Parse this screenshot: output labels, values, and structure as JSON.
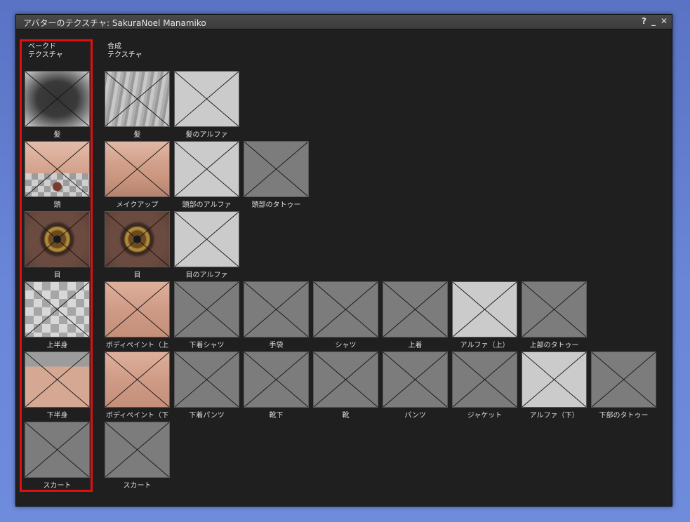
{
  "window": {
    "title": "アバターのテクスチャ: SakuraNoel Manamiko",
    "help_label": "?",
    "minimize_label": "_",
    "close_label": "✕"
  },
  "headers": {
    "baked": "ベークド\nテクスチャ",
    "composite": "合成\nテクスチャ"
  },
  "rows": [
    {
      "baked": "髪",
      "composite": [
        "髪",
        "髪のアルファ"
      ]
    },
    {
      "baked": "頭",
      "composite": [
        "メイクアップ",
        "頭部のアルファ",
        "頭部のタトゥー"
      ]
    },
    {
      "baked": "目",
      "composite": [
        "目",
        "目のアルファ"
      ]
    },
    {
      "baked": "上半身",
      "composite": [
        "ボディペイント（上",
        "下着シャツ",
        "手袋",
        "シャツ",
        "上着",
        "アルファ（上）",
        "上部のタトゥー"
      ]
    },
    {
      "baked": "下半身",
      "composite": [
        "ボディペイント（下",
        "下着パンツ",
        "靴下",
        "靴",
        "パンツ",
        "ジャケット",
        "アルファ（下）",
        "下部のタトゥー"
      ]
    },
    {
      "baked": "スカート",
      "composite": [
        "スカート"
      ]
    }
  ],
  "highlight_color": "#e01010"
}
